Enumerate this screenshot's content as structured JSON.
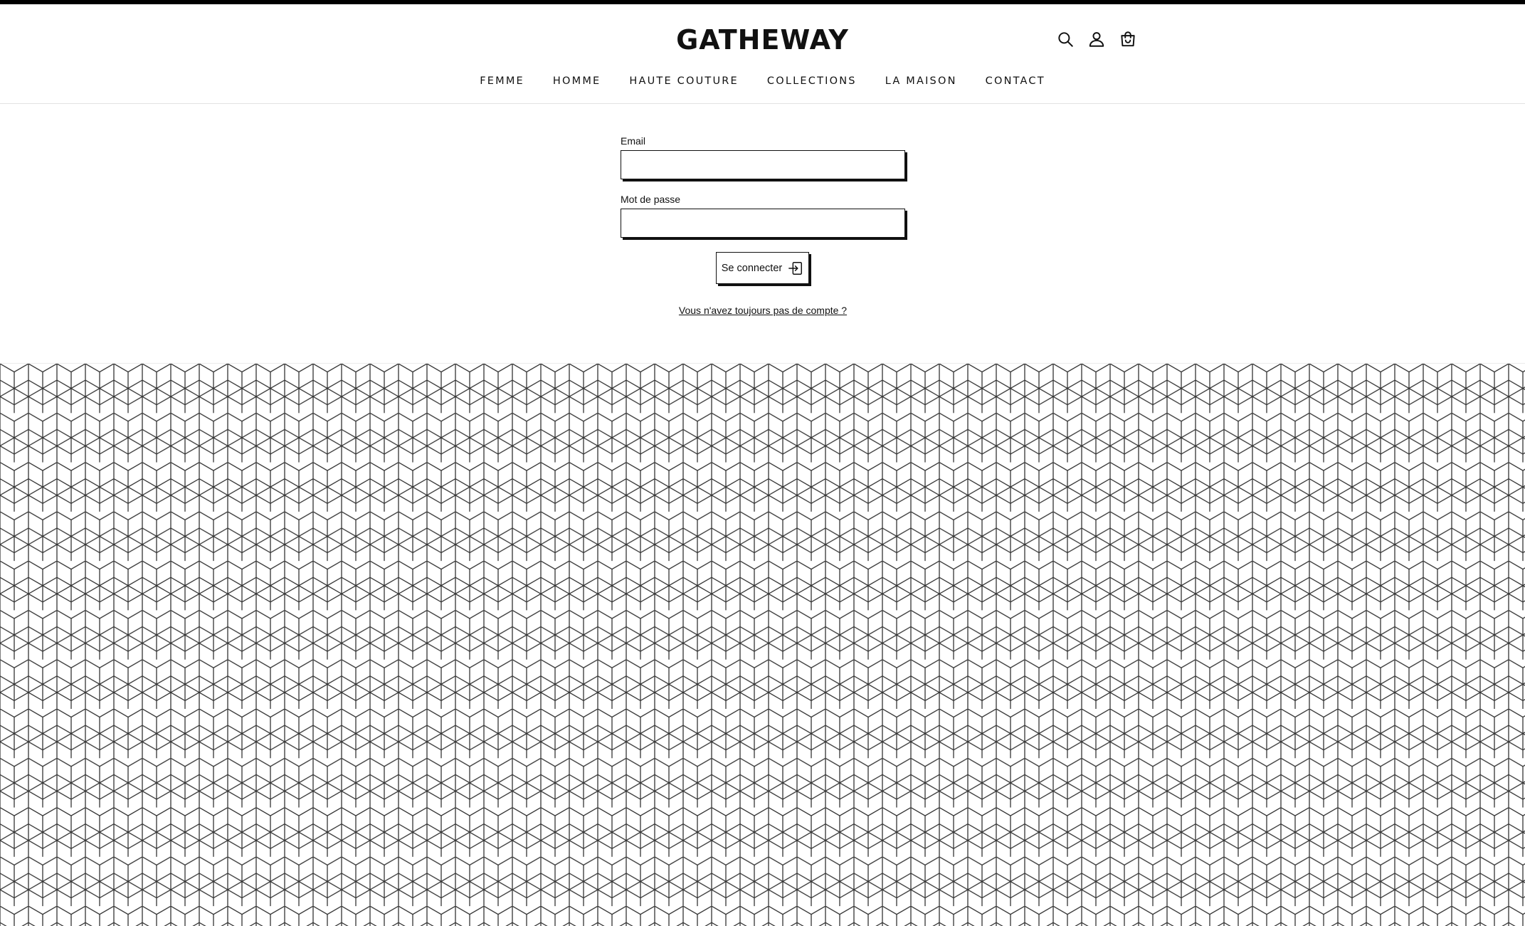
{
  "brand": {
    "name": "GATHEWAY"
  },
  "header_icons": [
    "search-icon",
    "account-icon",
    "cart-icon"
  ],
  "nav": {
    "items": [
      {
        "label": "FEMME"
      },
      {
        "label": "HOMME"
      },
      {
        "label": "HAUTE COUTURE"
      },
      {
        "label": "COLLECTIONS"
      },
      {
        "label": "LA MAISON"
      },
      {
        "label": "CONTACT"
      }
    ]
  },
  "login_form": {
    "email_label": "Email",
    "email_value": "",
    "password_label": "Mot de passe",
    "password_value": "",
    "submit_label": "Se connecter",
    "submit_icon": "login-icon",
    "register_link": "Vous n'avez toujours pas de compte ?"
  },
  "colors": {
    "text": "#111111",
    "background": "#ffffff",
    "accent": "#000000",
    "pattern_line": "#333333"
  }
}
